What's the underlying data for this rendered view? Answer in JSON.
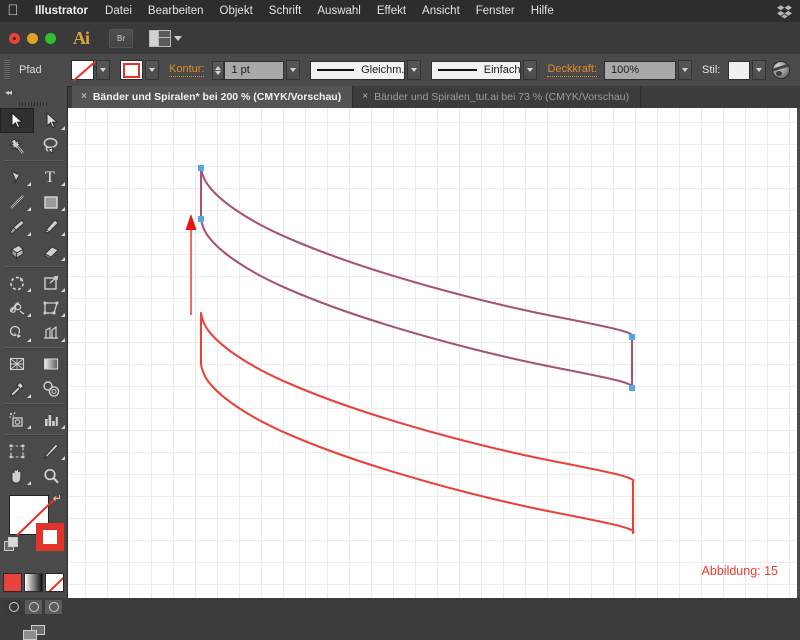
{
  "menubar": {
    "apple_icon": "apple-logo-icon",
    "app_name": "Illustrator",
    "items": [
      "Datei",
      "Bearbeiten",
      "Objekt",
      "Schrift",
      "Auswahl",
      "Effekt",
      "Ansicht",
      "Fenster",
      "Hilfe"
    ],
    "right_icon": "dropbox-icon"
  },
  "appbar": {
    "ai_logo": "Ai",
    "bridge_label": "Br",
    "arrange_icon": "arrange-documents-icon"
  },
  "controlbar": {
    "object_type": "Pfad",
    "fill_swatch": "none",
    "stroke_swatch": "red-square",
    "stroke_label": "Kontur:",
    "stroke_weight": "1 pt",
    "profile_label": "Gleichm.",
    "brush_label": "Einfach",
    "opacity_label": "Deckkraft:",
    "opacity_value": "100%",
    "style_label": "Stil:",
    "style_swatch": "white",
    "globe_icon": "recolor-artwork-icon"
  },
  "tabs": [
    {
      "title": "Bänder und Spiralen* bei 200 % (CMYK/Vorschau)",
      "active": true,
      "close": "×"
    },
    {
      "title": "Bänder und Spiralen_tut.ai bei 73 % (CMYK/Vorschau)",
      "active": false,
      "close": "×"
    }
  ],
  "toolpanel": {
    "collapse_icon": "collapse-panel-icon",
    "tools": [
      {
        "name": "selection-tool",
        "selected": true,
        "more": false
      },
      {
        "name": "direct-selection-tool",
        "selected": false,
        "more": true
      },
      {
        "name": "magic-wand-tool",
        "selected": false,
        "more": false
      },
      {
        "name": "lasso-tool",
        "selected": false,
        "more": false
      },
      {
        "name": "pen-tool",
        "selected": false,
        "more": true
      },
      {
        "name": "type-tool",
        "selected": false,
        "more": true
      },
      {
        "name": "line-segment-tool",
        "selected": false,
        "more": true
      },
      {
        "name": "rectangle-tool",
        "selected": false,
        "more": true
      },
      {
        "name": "paintbrush-tool",
        "selected": false,
        "more": true
      },
      {
        "name": "pencil-tool",
        "selected": false,
        "more": true
      },
      {
        "name": "blob-brush-tool",
        "selected": false,
        "more": false
      },
      {
        "name": "eraser-tool",
        "selected": false,
        "more": true
      },
      {
        "name": "rotate-tool",
        "selected": false,
        "more": true
      },
      {
        "name": "scale-tool",
        "selected": false,
        "more": true
      },
      {
        "name": "width-tool",
        "selected": false,
        "more": true
      },
      {
        "name": "free-transform-tool",
        "selected": false,
        "more": false
      },
      {
        "name": "shape-builder-tool",
        "selected": false,
        "more": true
      },
      {
        "name": "perspective-grid-tool",
        "selected": false,
        "more": true
      },
      {
        "name": "mesh-tool",
        "selected": false,
        "more": false
      },
      {
        "name": "gradient-tool",
        "selected": false,
        "more": false
      },
      {
        "name": "eyedropper-tool",
        "selected": false,
        "more": true
      },
      {
        "name": "blend-tool",
        "selected": false,
        "more": false
      },
      {
        "name": "symbol-sprayer-tool",
        "selected": false,
        "more": true
      },
      {
        "name": "column-graph-tool",
        "selected": false,
        "more": true
      },
      {
        "name": "artboard-tool",
        "selected": false,
        "more": false
      },
      {
        "name": "slice-tool",
        "selected": false,
        "more": true
      },
      {
        "name": "hand-tool",
        "selected": false,
        "more": true
      },
      {
        "name": "zoom-tool",
        "selected": false,
        "more": false
      }
    ],
    "fill_stroke": {
      "fill": "none",
      "stroke": "#e0332a",
      "swap_icon": "swap-fill-stroke-icon",
      "default_icon": "default-fill-stroke-icon"
    },
    "color_modes": [
      "color-mode",
      "gradient-mode",
      "none-mode"
    ],
    "draw_modes": [
      "draw-normal",
      "draw-behind",
      "draw-inside"
    ],
    "screen_mode": "change-screen-mode-icon"
  },
  "canvas": {
    "caption": "Abbildung: 15",
    "caption_color": "#ee3a30",
    "grid_visible": true,
    "shapes": {
      "selected_stroke_color": "#8b5f9e",
      "path_stroke_color": "#e8433a",
      "anchor_color": "#5aa9e6",
      "arrow_color": "#e8433a"
    }
  },
  "chart_data": {
    "type": "line",
    "title": "",
    "series": [
      {
        "name": "upper-selected-band-top",
        "color": "#8b5f9e",
        "points": [
          [
            201,
            168
          ],
          [
            240,
            192
          ],
          [
            330,
            228
          ],
          [
            450,
            258
          ],
          [
            560,
            284
          ],
          [
            620,
            300
          ],
          [
            632,
            313
          ]
        ]
      },
      {
        "name": "upper-selected-band-bottom",
        "color": "#8b5f9e",
        "points": [
          [
            201,
            219
          ],
          [
            240,
            243
          ],
          [
            330,
            280
          ],
          [
            450,
            310
          ],
          [
            560,
            336
          ],
          [
            622,
            352
          ],
          [
            632,
            365
          ]
        ]
      },
      {
        "name": "lower-band-top",
        "color": "#e8433a",
        "points": [
          [
            201,
            313
          ],
          [
            240,
            337
          ],
          [
            330,
            374
          ],
          [
            450,
            404
          ],
          [
            560,
            430
          ],
          [
            622,
            446
          ],
          [
            633,
            459
          ]
        ]
      },
      {
        "name": "lower-band-bottom",
        "color": "#e8433a",
        "points": [
          [
            201,
            364
          ],
          [
            240,
            388
          ],
          [
            330,
            425
          ],
          [
            450,
            455
          ],
          [
            560,
            481
          ],
          [
            622,
            497
          ],
          [
            633,
            510
          ]
        ]
      }
    ],
    "anchors": [
      [
        201,
        168
      ],
      [
        201,
        219
      ],
      [
        632,
        313
      ],
      [
        632,
        365
      ]
    ],
    "annotation_arrow": {
      "from": [
        191,
        315
      ],
      "to": [
        191,
        222
      ],
      "color": "#e8433a"
    }
  }
}
